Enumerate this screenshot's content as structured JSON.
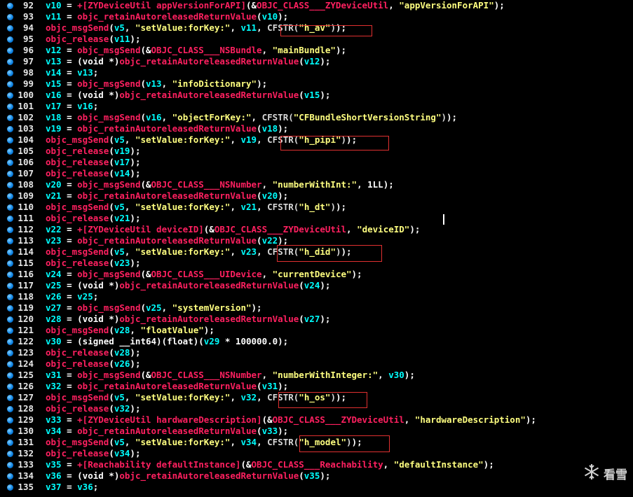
{
  "lines": [
    {
      "n": "92",
      "segs": [
        [
          "v",
          "v10"
        ],
        [
          "o",
          " = "
        ],
        [
          "f",
          "+[ZYDeviceUtil appVersionForAPI]"
        ],
        [
          "o",
          "(&"
        ],
        [
          "f",
          "OBJC_CLASS___ZYDeviceUtil"
        ],
        [
          "o",
          ", "
        ],
        [
          "s",
          "\"appVersionForAPI\""
        ],
        [
          "o",
          ");"
        ]
      ]
    },
    {
      "n": "93",
      "segs": [
        [
          "v",
          "v11"
        ],
        [
          "o",
          " = "
        ],
        [
          "f",
          "objc_retainAutoreleasedReturnValue"
        ],
        [
          "o",
          "("
        ],
        [
          "v",
          "v10"
        ],
        [
          "o",
          ");"
        ]
      ]
    },
    {
      "n": "94",
      "segs": [
        [
          "f",
          "objc_msgSend"
        ],
        [
          "o",
          "("
        ],
        [
          "v",
          "v5"
        ],
        [
          "o",
          ", "
        ],
        [
          "s",
          "\"setValue:forKey:\""
        ],
        [
          "o",
          ", "
        ],
        [
          "v",
          "v11"
        ],
        [
          "o",
          ", "
        ],
        [
          "cs",
          "CFSTR("
        ],
        [
          "s",
          "\"h_av\""
        ],
        [
          "cs",
          ")"
        ],
        [
          "o",
          ");"
        ]
      ]
    },
    {
      "n": "95",
      "segs": [
        [
          "f",
          "objc_release"
        ],
        [
          "o",
          "("
        ],
        [
          "v",
          "v11"
        ],
        [
          "o",
          ");"
        ]
      ]
    },
    {
      "n": "96",
      "segs": [
        [
          "v",
          "v12"
        ],
        [
          "o",
          " = "
        ],
        [
          "f",
          "objc_msgSend"
        ],
        [
          "o",
          "(&"
        ],
        [
          "f",
          "OBJC_CLASS___NSBundle"
        ],
        [
          "o",
          ", "
        ],
        [
          "s",
          "\"mainBundle\""
        ],
        [
          "o",
          ");"
        ]
      ]
    },
    {
      "n": "97",
      "segs": [
        [
          "v",
          "v13"
        ],
        [
          "o",
          " = "
        ],
        [
          "k",
          "(void *)"
        ],
        [
          "f",
          "objc_retainAutoreleasedReturnValue"
        ],
        [
          "o",
          "("
        ],
        [
          "v",
          "v12"
        ],
        [
          "o",
          ");"
        ]
      ]
    },
    {
      "n": "98",
      "segs": [
        [
          "v",
          "v14"
        ],
        [
          "o",
          " = "
        ],
        [
          "v",
          "v13"
        ],
        [
          "o",
          ";"
        ]
      ]
    },
    {
      "n": "99",
      "segs": [
        [
          "v",
          "v15"
        ],
        [
          "o",
          " = "
        ],
        [
          "f",
          "objc_msgSend"
        ],
        [
          "o",
          "("
        ],
        [
          "v",
          "v13"
        ],
        [
          "o",
          ", "
        ],
        [
          "s",
          "\"infoDictionary\""
        ],
        [
          "o",
          ");"
        ]
      ]
    },
    {
      "n": "100",
      "segs": [
        [
          "v",
          "v16"
        ],
        [
          "o",
          " = "
        ],
        [
          "k",
          "(void *)"
        ],
        [
          "f",
          "objc_retainAutoreleasedReturnValue"
        ],
        [
          "o",
          "("
        ],
        [
          "v",
          "v15"
        ],
        [
          "o",
          ");"
        ]
      ]
    },
    {
      "n": "101",
      "segs": [
        [
          "v",
          "v17"
        ],
        [
          "o",
          " = "
        ],
        [
          "v",
          "v16"
        ],
        [
          "o",
          ";"
        ]
      ]
    },
    {
      "n": "102",
      "segs": [
        [
          "v",
          "v18"
        ],
        [
          "o",
          " = "
        ],
        [
          "f",
          "objc_msgSend"
        ],
        [
          "o",
          "("
        ],
        [
          "v",
          "v16"
        ],
        [
          "o",
          ", "
        ],
        [
          "s",
          "\"objectForKey:\""
        ],
        [
          "o",
          ", "
        ],
        [
          "cs",
          "CFSTR("
        ],
        [
          "s",
          "\"CFBundleShortVersionString\""
        ],
        [
          "cs",
          ")"
        ],
        [
          "o",
          ");"
        ]
      ]
    },
    {
      "n": "103",
      "segs": [
        [
          "v",
          "v19"
        ],
        [
          "o",
          " = "
        ],
        [
          "f",
          "objc_retainAutoreleasedReturnValue"
        ],
        [
          "o",
          "("
        ],
        [
          "v",
          "v18"
        ],
        [
          "o",
          ");"
        ]
      ]
    },
    {
      "n": "104",
      "segs": [
        [
          "f",
          "objc_msgSend"
        ],
        [
          "o",
          "("
        ],
        [
          "v",
          "v5"
        ],
        [
          "o",
          ", "
        ],
        [
          "s",
          "\"setValue:forKey:\""
        ],
        [
          "o",
          ", "
        ],
        [
          "v",
          "v19"
        ],
        [
          "o",
          ", "
        ],
        [
          "cs",
          "CFSTR("
        ],
        [
          "s",
          "\"h_pipi\""
        ],
        [
          "cs",
          ")"
        ],
        [
          "o",
          ");"
        ]
      ]
    },
    {
      "n": "105",
      "segs": [
        [
          "f",
          "objc_release"
        ],
        [
          "o",
          "("
        ],
        [
          "v",
          "v19"
        ],
        [
          "o",
          ");"
        ]
      ]
    },
    {
      "n": "106",
      "segs": [
        [
          "f",
          "objc_release"
        ],
        [
          "o",
          "("
        ],
        [
          "v",
          "v17"
        ],
        [
          "o",
          ");"
        ]
      ]
    },
    {
      "n": "107",
      "segs": [
        [
          "f",
          "objc_release"
        ],
        [
          "o",
          "("
        ],
        [
          "v",
          "v14"
        ],
        [
          "o",
          ");"
        ]
      ]
    },
    {
      "n": "108",
      "segs": [
        [
          "v",
          "v20"
        ],
        [
          "o",
          " = "
        ],
        [
          "f",
          "objc_msgSend"
        ],
        [
          "o",
          "(&"
        ],
        [
          "f",
          "OBJC_CLASS___NSNumber"
        ],
        [
          "o",
          ", "
        ],
        [
          "s",
          "\"numberWithInt:\""
        ],
        [
          "o",
          ", 1LL);"
        ]
      ]
    },
    {
      "n": "109",
      "segs": [
        [
          "v",
          "v21"
        ],
        [
          "o",
          " = "
        ],
        [
          "f",
          "objc_retainAutoreleasedReturnValue"
        ],
        [
          "o",
          "("
        ],
        [
          "v",
          "v20"
        ],
        [
          "o",
          ");"
        ]
      ]
    },
    {
      "n": "110",
      "segs": [
        [
          "f",
          "objc_msgSend"
        ],
        [
          "o",
          "("
        ],
        [
          "v",
          "v5"
        ],
        [
          "o",
          ", "
        ],
        [
          "s",
          "\"setValue:forKey:\""
        ],
        [
          "o",
          ", "
        ],
        [
          "v",
          "v21"
        ],
        [
          "o",
          ", "
        ],
        [
          "cs",
          "CFSTR("
        ],
        [
          "s",
          "\"h_dt\""
        ],
        [
          "cs",
          ")"
        ],
        [
          "o",
          ");"
        ]
      ]
    },
    {
      "n": "111",
      "segs": [
        [
          "f",
          "objc_release"
        ],
        [
          "o",
          "("
        ],
        [
          "v",
          "v21"
        ],
        [
          "o",
          ");"
        ]
      ]
    },
    {
      "n": "112",
      "segs": [
        [
          "v",
          "v22"
        ],
        [
          "o",
          " = "
        ],
        [
          "f",
          "+[ZYDeviceUtil deviceID]"
        ],
        [
          "o",
          "(&"
        ],
        [
          "f",
          "OBJC_CLASS___ZYDeviceUtil"
        ],
        [
          "o",
          ", "
        ],
        [
          "s",
          "\"deviceID\""
        ],
        [
          "o",
          ");"
        ]
      ]
    },
    {
      "n": "113",
      "segs": [
        [
          "v",
          "v23"
        ],
        [
          "o",
          " = "
        ],
        [
          "f",
          "objc_retainAutoreleasedReturnValue"
        ],
        [
          "o",
          "("
        ],
        [
          "v",
          "v22"
        ],
        [
          "o",
          ");"
        ]
      ]
    },
    {
      "n": "114",
      "segs": [
        [
          "f",
          "objc_msgSend"
        ],
        [
          "o",
          "("
        ],
        [
          "v",
          "v5"
        ],
        [
          "o",
          ", "
        ],
        [
          "s",
          "\"setValue:forKey:\""
        ],
        [
          "o",
          ", "
        ],
        [
          "v",
          "v23"
        ],
        [
          "o",
          ", "
        ],
        [
          "cs",
          "CFSTR("
        ],
        [
          "s",
          "\"h_did\""
        ],
        [
          "cs",
          ")"
        ],
        [
          "o",
          ");"
        ]
      ]
    },
    {
      "n": "115",
      "segs": [
        [
          "f",
          "objc_release"
        ],
        [
          "o",
          "("
        ],
        [
          "v",
          "v23"
        ],
        [
          "o",
          ");"
        ]
      ]
    },
    {
      "n": "116",
      "segs": [
        [
          "v",
          "v24"
        ],
        [
          "o",
          " = "
        ],
        [
          "f",
          "objc_msgSend"
        ],
        [
          "o",
          "(&"
        ],
        [
          "f",
          "OBJC_CLASS___UIDevice"
        ],
        [
          "o",
          ", "
        ],
        [
          "s",
          "\"currentDevice\""
        ],
        [
          "o",
          ");"
        ]
      ]
    },
    {
      "n": "117",
      "segs": [
        [
          "v",
          "v25"
        ],
        [
          "o",
          " = "
        ],
        [
          "k",
          "(void *)"
        ],
        [
          "f",
          "objc_retainAutoreleasedReturnValue"
        ],
        [
          "o",
          "("
        ],
        [
          "v",
          "v24"
        ],
        [
          "o",
          ");"
        ]
      ]
    },
    {
      "n": "118",
      "segs": [
        [
          "v",
          "v26"
        ],
        [
          "o",
          " = "
        ],
        [
          "v",
          "v25"
        ],
        [
          "o",
          ";"
        ]
      ]
    },
    {
      "n": "119",
      "segs": [
        [
          "v",
          "v27"
        ],
        [
          "o",
          " = "
        ],
        [
          "f",
          "objc_msgSend"
        ],
        [
          "o",
          "("
        ],
        [
          "v",
          "v25"
        ],
        [
          "o",
          ", "
        ],
        [
          "s",
          "\"systemVersion\""
        ],
        [
          "o",
          ");"
        ]
      ]
    },
    {
      "n": "120",
      "segs": [
        [
          "v",
          "v28"
        ],
        [
          "o",
          " = "
        ],
        [
          "k",
          "(void *)"
        ],
        [
          "f",
          "objc_retainAutoreleasedReturnValue"
        ],
        [
          "o",
          "("
        ],
        [
          "v",
          "v27"
        ],
        [
          "o",
          ");"
        ]
      ]
    },
    {
      "n": "121",
      "segs": [
        [
          "f",
          "objc_msgSend"
        ],
        [
          "o",
          "("
        ],
        [
          "v",
          "v28"
        ],
        [
          "o",
          ", "
        ],
        [
          "s",
          "\"floatValue\""
        ],
        [
          "o",
          ");"
        ]
      ]
    },
    {
      "n": "122",
      "segs": [
        [
          "v",
          "v30"
        ],
        [
          "o",
          " = (signed __int64)(float)("
        ],
        [
          "v",
          "v29"
        ],
        [
          "o",
          " * 100000.0);"
        ]
      ]
    },
    {
      "n": "123",
      "segs": [
        [
          "f",
          "objc_release"
        ],
        [
          "o",
          "("
        ],
        [
          "v",
          "v28"
        ],
        [
          "o",
          ");"
        ]
      ]
    },
    {
      "n": "124",
      "segs": [
        [
          "f",
          "objc_release"
        ],
        [
          "o",
          "("
        ],
        [
          "v",
          "v26"
        ],
        [
          "o",
          ");"
        ]
      ]
    },
    {
      "n": "125",
      "segs": [
        [
          "v",
          "v31"
        ],
        [
          "o",
          " = "
        ],
        [
          "f",
          "objc_msgSend"
        ],
        [
          "o",
          "(&"
        ],
        [
          "f",
          "OBJC_CLASS___NSNumber"
        ],
        [
          "o",
          ", "
        ],
        [
          "s",
          "\"numberWithInteger:\""
        ],
        [
          "o",
          ", "
        ],
        [
          "v",
          "v30"
        ],
        [
          "o",
          ");"
        ]
      ]
    },
    {
      "n": "126",
      "segs": [
        [
          "v",
          "v32"
        ],
        [
          "o",
          " = "
        ],
        [
          "f",
          "objc_retainAutoreleasedReturnValue"
        ],
        [
          "o",
          "("
        ],
        [
          "v",
          "v31"
        ],
        [
          "o",
          ");"
        ]
      ]
    },
    {
      "n": "127",
      "segs": [
        [
          "f",
          "objc_msgSend"
        ],
        [
          "o",
          "("
        ],
        [
          "v",
          "v5"
        ],
        [
          "o",
          ", "
        ],
        [
          "s",
          "\"setValue:forKey:\""
        ],
        [
          "o",
          ", "
        ],
        [
          "v",
          "v32"
        ],
        [
          "o",
          ", "
        ],
        [
          "cs",
          "CFSTR("
        ],
        [
          "s",
          "\"h_os\""
        ],
        [
          "cs",
          ")"
        ],
        [
          "o",
          ");"
        ]
      ]
    },
    {
      "n": "128",
      "segs": [
        [
          "f",
          "objc_release"
        ],
        [
          "o",
          "("
        ],
        [
          "v",
          "v32"
        ],
        [
          "o",
          ");"
        ]
      ]
    },
    {
      "n": "129",
      "segs": [
        [
          "v",
          "v33"
        ],
        [
          "o",
          " = "
        ],
        [
          "f",
          "+[ZYDeviceUtil hardwareDescription]"
        ],
        [
          "o",
          "(&"
        ],
        [
          "f",
          "OBJC_CLASS___ZYDeviceUtil"
        ],
        [
          "o",
          ", "
        ],
        [
          "s",
          "\"hardwareDescription\""
        ],
        [
          "o",
          ");"
        ]
      ]
    },
    {
      "n": "130",
      "segs": [
        [
          "v",
          "v34"
        ],
        [
          "o",
          " = "
        ],
        [
          "f",
          "objc_retainAutoreleasedReturnValue"
        ],
        [
          "o",
          "("
        ],
        [
          "v",
          "v33"
        ],
        [
          "o",
          ");"
        ]
      ]
    },
    {
      "n": "131",
      "segs": [
        [
          "f",
          "objc_msgSend"
        ],
        [
          "o",
          "("
        ],
        [
          "v",
          "v5"
        ],
        [
          "o",
          ", "
        ],
        [
          "s",
          "\"setValue:forKey:\""
        ],
        [
          "o",
          ", "
        ],
        [
          "v",
          "v34"
        ],
        [
          "o",
          ", "
        ],
        [
          "cs",
          "CFSTR("
        ],
        [
          "s",
          "\"h_model\""
        ],
        [
          "cs",
          ")"
        ],
        [
          "o",
          ");"
        ]
      ]
    },
    {
      "n": "132",
      "segs": [
        [
          "f",
          "objc_release"
        ],
        [
          "o",
          "("
        ],
        [
          "v",
          "v34"
        ],
        [
          "o",
          ");"
        ]
      ]
    },
    {
      "n": "133",
      "segs": [
        [
          "v",
          "v35"
        ],
        [
          "o",
          " = "
        ],
        [
          "f",
          "+[Reachability defaultInstance]"
        ],
        [
          "o",
          "(&"
        ],
        [
          "f",
          "OBJC_CLASS___Reachability"
        ],
        [
          "o",
          ", "
        ],
        [
          "s",
          "\"defaultInstance\""
        ],
        [
          "o",
          ");"
        ]
      ]
    },
    {
      "n": "134",
      "segs": [
        [
          "v",
          "v36"
        ],
        [
          "o",
          " = "
        ],
        [
          "k",
          "(void *)"
        ],
        [
          "f",
          "objc_retainAutoreleasedReturnValue"
        ],
        [
          "o",
          "("
        ],
        [
          "v",
          "v35"
        ],
        [
          "o",
          ");"
        ]
      ]
    },
    {
      "n": "135",
      "segs": [
        [
          "v",
          "v37"
        ],
        [
          "o",
          " = "
        ],
        [
          "v",
          "v36"
        ],
        [
          "o",
          ";"
        ]
      ]
    }
  ],
  "watermark": {
    "text": "看雪",
    "icon": "snowflake-icon"
  },
  "colors": {
    "background": "#000000",
    "variable": "#00ffff",
    "function": "#ff2060",
    "string": "#ffff80",
    "highlight_box": "#e03030",
    "breakpoint_dot": "#0a7fe0"
  }
}
